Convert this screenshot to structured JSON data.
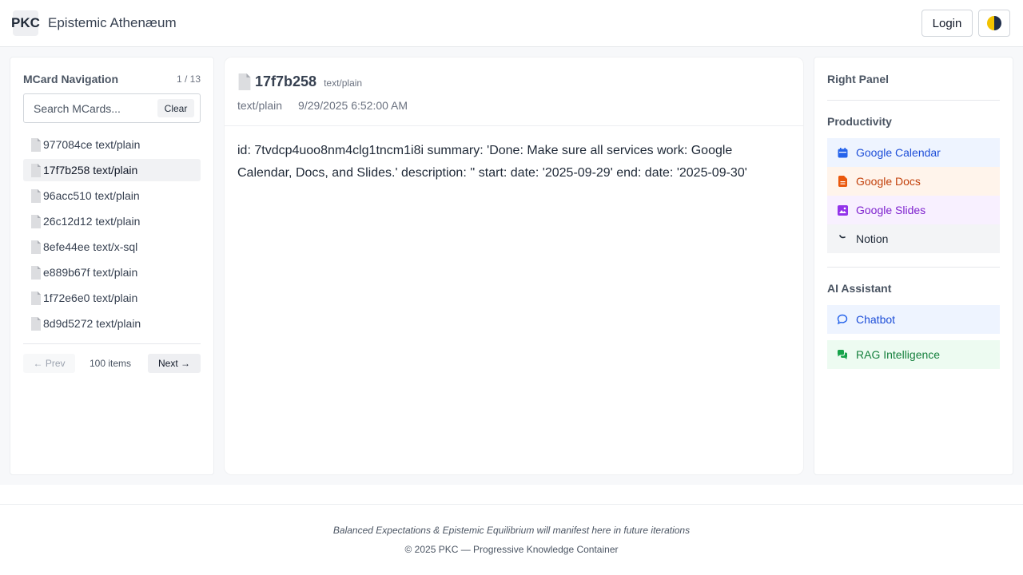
{
  "header": {
    "logo": "PKC",
    "app_title": "Epistemic Athenæum",
    "login_label": "Login",
    "theme_icon": "half-moon-theme-icon"
  },
  "sidebar": {
    "title": "MCard Navigation",
    "page_indicator": "1 / 13",
    "search_placeholder": "Search MCards...",
    "clear_label": "Clear",
    "items": [
      {
        "label": "977084ce text/plain",
        "active": false
      },
      {
        "label": "17f7b258 text/plain",
        "active": true
      },
      {
        "label": "96acc510 text/plain",
        "active": false
      },
      {
        "label": "26c12d12 text/plain",
        "active": false
      },
      {
        "label": "8efe44ee text/x-sql",
        "active": false
      },
      {
        "label": "e889b67f text/plain",
        "active": false
      },
      {
        "label": "1f72e6e0 text/plain",
        "active": false
      },
      {
        "label": "8d9d5272 text/plain",
        "active": false
      }
    ],
    "prev_label": "← Prev",
    "items_count": "100 items",
    "next_label": "Next →"
  },
  "main": {
    "title": "17f7b258",
    "type_tag": "text/plain",
    "meta_type": "text/plain",
    "meta_date": "9/29/2025 6:52:00 AM",
    "content": "id: 7tvdcp4uoo8nm4clg1tncm1i8i summary: 'Done: Make sure all services work: Google Calendar, Docs, and Slides.' description: '' start: date: '2025-09-29' end: date: '2025-09-30'"
  },
  "right_panel": {
    "title": "Right Panel",
    "productivity": {
      "title": "Productivity",
      "items": [
        {
          "label": "Google Calendar",
          "icon": "calendar-icon",
          "color": "#1d4ed8",
          "bg": "#eef4ff"
        },
        {
          "label": "Google Docs",
          "icon": "document-icon",
          "color": "#c2410c",
          "bg": "#fff4eb"
        },
        {
          "label": "Google Slides",
          "icon": "image-icon",
          "color": "#7e22ce",
          "bg": "#f8f0ff"
        },
        {
          "label": "Notion",
          "icon": "notion-icon",
          "color": "#1f2937",
          "bg": "#f3f4f6"
        }
      ]
    },
    "ai_assistant": {
      "title": "AI Assistant",
      "items": [
        {
          "label": "Chatbot",
          "icon": "chat-bubble-icon",
          "color": "#1d4ed8",
          "bg": "#eef4ff"
        },
        {
          "label": "RAG Intelligence",
          "icon": "chat-bubbles-icon",
          "color": "#15803d",
          "bg": "#edfbf1"
        }
      ]
    }
  },
  "footer": {
    "tagline": "Balanced Expectations & Epistemic Equilibrium will manifest here in future iterations",
    "copyright": "© 2025 PKC — Progressive Knowledge Container"
  }
}
